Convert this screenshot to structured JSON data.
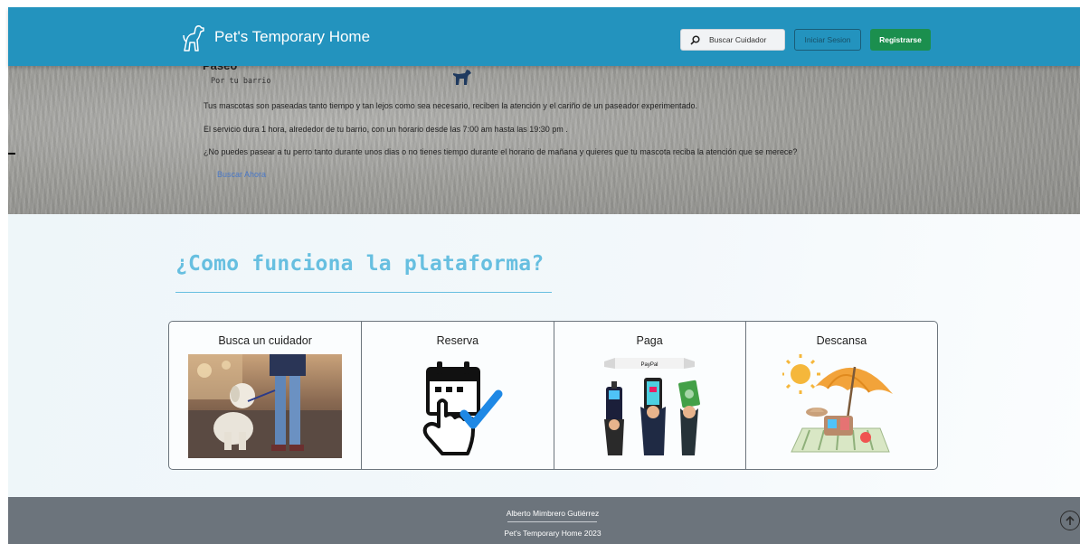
{
  "navbar": {
    "brand": "Pet's Temporary Home",
    "search_label": "Buscar Cuidador",
    "login_label": "Iniciar Sesion",
    "register_label": "Registrarse",
    "color": "#2393be"
  },
  "hero": {
    "title": "Paseo",
    "subtitle": "Por tu barrio",
    "paragraphs": [
      "Tus mascotas son paseadas tanto tiempo y tan lejos como sea necesario, reciben la atención y el cariño de un paseador experimentado.",
      "El servicio dura 1 hora, alrededor de tu barrio, con un horario desde las 7:00 am hasta las 19:30 pm .",
      "¿No puedes pasear a tu perro tanto durante unos dias o no tienes tiempo durante el horario de mañana y quieres que tu mascota reciba la atención que se merece?"
    ],
    "link": "Buscar Ahora"
  },
  "how": {
    "title": "¿Como funciona la plataforma?",
    "accent": "#67bfe0",
    "cards": [
      {
        "title": "Busca un cuidador",
        "icon": "person-with-dog-photo"
      },
      {
        "title": "Reserva",
        "icon": "calendar-touch-check-icon"
      },
      {
        "title": "Paga",
        "icon": "payment-methods-icon"
      },
      {
        "title": "Descansa",
        "icon": "beach-umbrella-icon"
      }
    ],
    "paypal_label": "PayPal"
  },
  "footer": {
    "name": "Alberto Mimbrero Gutiérrez",
    "copyright": "Pet's Temporary Home 2023",
    "color": "#6c747c"
  }
}
